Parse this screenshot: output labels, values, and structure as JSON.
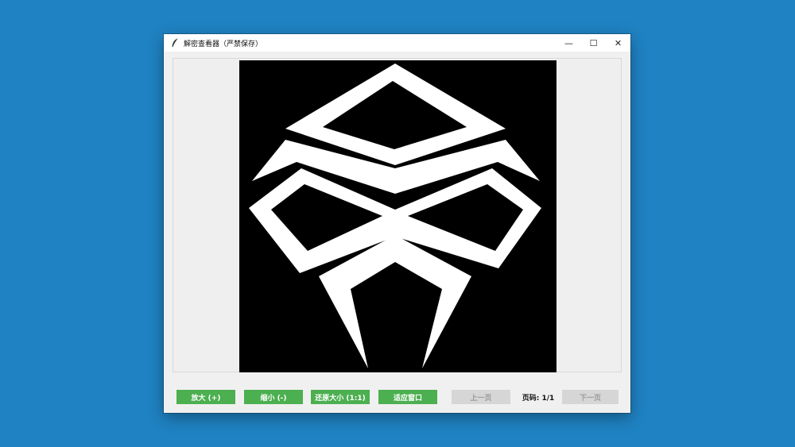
{
  "window": {
    "title": "解密查看器（严禁保存）",
    "controls": {
      "minimize": "—",
      "maximize": "☐",
      "close": "✕"
    }
  },
  "viewer": {
    "image_icon": "tribal-mask-symbol"
  },
  "toolbar": {
    "zoom_in": "放大 (+)",
    "zoom_out": "缩小 (-)",
    "reset_size": "还原大小 (1:1)",
    "fit_window": "适应窗口",
    "prev_page": "上一页",
    "page_indicator": "页码: 1/1",
    "next_page": "下一页"
  },
  "colors": {
    "desktop": "#1f82c2",
    "button_green": "#4caf50",
    "button_disabled": "#d6d6d6"
  }
}
